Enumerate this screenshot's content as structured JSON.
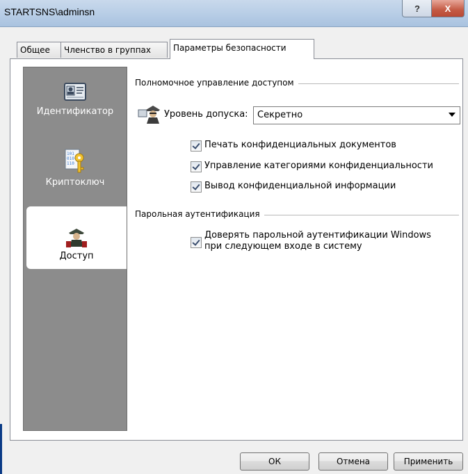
{
  "window": {
    "title": "STARTSNS\\adminsn",
    "help_label": "?",
    "close_label": "X"
  },
  "tabs": [
    {
      "label": "Общее"
    },
    {
      "label": "Членство в группах"
    },
    {
      "label": "Параметры безопасности"
    }
  ],
  "sidebar": {
    "items": [
      {
        "label": "Идентификатор",
        "icon": "id-card-icon"
      },
      {
        "label": "Криптоключ",
        "icon": "crypto-key-icon"
      },
      {
        "label": "Доступ",
        "icon": "access-agent-icon",
        "selected": true
      }
    ]
  },
  "access_group": {
    "title": "Полномочное управление доступом",
    "level_label": "Уровень допуска:",
    "level_value": "Секретно",
    "checkboxes": [
      {
        "label": "Печать конфиденциальных документов",
        "checked": true
      },
      {
        "label": "Управление категориями конфиденциальности",
        "checked": true
      },
      {
        "label": "Вывод конфиденциальной информации",
        "checked": true
      }
    ]
  },
  "password_group": {
    "title": "Парольная аутентификация",
    "trust_line1": "Доверять парольной аутентификации Windows",
    "trust_line2": "при следующем входе в систему",
    "trust_checked": true
  },
  "buttons": {
    "ok": "ОК",
    "cancel": "Отмена",
    "apply": "Применить"
  }
}
